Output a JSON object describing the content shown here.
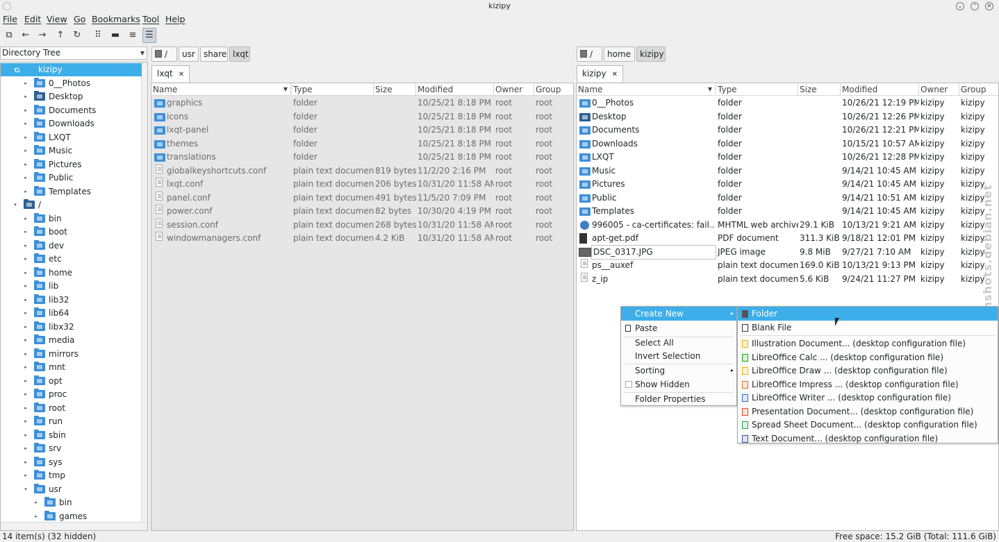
{
  "window": {
    "title": "kizipy"
  },
  "menubar": [
    "File",
    "Edit",
    "View",
    "Go",
    "Bookmarks",
    "Tool",
    "Help"
  ],
  "sidebar": {
    "combo": "Directory Tree",
    "tree": [
      {
        "label": "kizipy",
        "depth": 0,
        "exp": "▾",
        "selected": true,
        "icon": "home"
      },
      {
        "label": "0__Photos",
        "depth": 1,
        "exp": "▸"
      },
      {
        "label": "Desktop",
        "depth": 1,
        "exp": "▸",
        "icon": "dark"
      },
      {
        "label": "Documents",
        "depth": 1,
        "exp": "▸"
      },
      {
        "label": "Downloads",
        "depth": 1,
        "exp": "▸"
      },
      {
        "label": "LXQT",
        "depth": 1,
        "exp": "▸"
      },
      {
        "label": "Music",
        "depth": 1,
        "exp": "▸"
      },
      {
        "label": "Pictures",
        "depth": 1,
        "exp": "▸"
      },
      {
        "label": "Public",
        "depth": 1,
        "exp": "▸"
      },
      {
        "label": "Templates",
        "depth": 1,
        "exp": "▸"
      },
      {
        "label": "/",
        "depth": 0,
        "exp": "▾",
        "icon": "dark"
      },
      {
        "label": "bin",
        "depth": 1,
        "exp": "▸"
      },
      {
        "label": "boot",
        "depth": 1,
        "exp": "▸"
      },
      {
        "label": "dev",
        "depth": 1,
        "exp": "▸"
      },
      {
        "label": "etc",
        "depth": 1,
        "exp": "▸"
      },
      {
        "label": "home",
        "depth": 1,
        "exp": "▸"
      },
      {
        "label": "lib",
        "depth": 1,
        "exp": "▸"
      },
      {
        "label": "lib32",
        "depth": 1,
        "exp": "▸"
      },
      {
        "label": "lib64",
        "depth": 1,
        "exp": "▸"
      },
      {
        "label": "libx32",
        "depth": 1,
        "exp": "▸"
      },
      {
        "label": "media",
        "depth": 1,
        "exp": "▸"
      },
      {
        "label": "mirrors",
        "depth": 1,
        "exp": "▸"
      },
      {
        "label": "mnt",
        "depth": 1,
        "exp": "▸"
      },
      {
        "label": "opt",
        "depth": 1,
        "exp": "▸"
      },
      {
        "label": "proc",
        "depth": 1,
        "exp": "▸"
      },
      {
        "label": "root",
        "depth": 1,
        "exp": "▸"
      },
      {
        "label": "run",
        "depth": 1,
        "exp": "▸"
      },
      {
        "label": "sbin",
        "depth": 1,
        "exp": "▸"
      },
      {
        "label": "srv",
        "depth": 1,
        "exp": "▸"
      },
      {
        "label": "sys",
        "depth": 1,
        "exp": "▸"
      },
      {
        "label": "tmp",
        "depth": 1,
        "exp": "▸"
      },
      {
        "label": "usr",
        "depth": 1,
        "exp": "▾"
      },
      {
        "label": "bin",
        "depth": 2,
        "exp": "▸"
      },
      {
        "label": "games",
        "depth": 2,
        "exp": "▸"
      }
    ]
  },
  "left": {
    "path": [
      "/",
      "usr",
      "share",
      "lxqt"
    ],
    "tab": "lxqt",
    "headers": [
      "Name",
      "Type",
      "Size",
      "Modified",
      "Owner",
      "Group"
    ],
    "files": [
      {
        "name": "graphics",
        "type": "folder",
        "size": "",
        "modified": "10/25/21 8:18 PM",
        "owner": "root",
        "group": "root",
        "kind": "folder"
      },
      {
        "name": "icons",
        "type": "folder",
        "size": "",
        "modified": "10/25/21 8:18 PM",
        "owner": "root",
        "group": "root",
        "kind": "folder"
      },
      {
        "name": "lxqt-panel",
        "type": "folder",
        "size": "",
        "modified": "10/25/21 8:18 PM",
        "owner": "root",
        "group": "root",
        "kind": "folder"
      },
      {
        "name": "themes",
        "type": "folder",
        "size": "",
        "modified": "10/25/21 8:18 PM",
        "owner": "root",
        "group": "root",
        "kind": "folder"
      },
      {
        "name": "translations",
        "type": "folder",
        "size": "",
        "modified": "10/25/21 8:18 PM",
        "owner": "root",
        "group": "root",
        "kind": "folder"
      },
      {
        "name": "globalkeyshortcuts.conf",
        "type": "plain text document",
        "size": "819 bytes",
        "modified": "11/2/20 2:16 PM",
        "owner": "root",
        "group": "root",
        "kind": "text"
      },
      {
        "name": "lxqt.conf",
        "type": "plain text document",
        "size": "206 bytes",
        "modified": "10/31/20 11:58 AM",
        "owner": "root",
        "group": "root",
        "kind": "text"
      },
      {
        "name": "panel.conf",
        "type": "plain text document",
        "size": "491 bytes",
        "modified": "11/5/20 7:09 PM",
        "owner": "root",
        "group": "root",
        "kind": "text"
      },
      {
        "name": "power.conf",
        "type": "plain text document",
        "size": "82 bytes",
        "modified": "10/30/20 4:19 PM",
        "owner": "root",
        "group": "root",
        "kind": "text"
      },
      {
        "name": "session.conf",
        "type": "plain text document",
        "size": "268 bytes",
        "modified": "10/31/20 11:58 AM",
        "owner": "root",
        "group": "root",
        "kind": "text"
      },
      {
        "name": "windowmanagers.conf",
        "type": "plain text document",
        "size": "4.2  KiB",
        "modified": "10/31/20 11:58 AM",
        "owner": "root",
        "group": "root",
        "kind": "text"
      }
    ]
  },
  "right": {
    "path": [
      "/",
      "home",
      "kizipy"
    ],
    "tab": "kizipy",
    "headers": [
      "Name",
      "Type",
      "Size",
      "Modified",
      "Owner",
      "Group"
    ],
    "files": [
      {
        "name": "0__Photos",
        "type": "folder",
        "size": "",
        "modified": "10/26/21 12:19 PM",
        "owner": "kizipy",
        "group": "kizipy",
        "kind": "folder"
      },
      {
        "name": "Desktop",
        "type": "folder",
        "size": "",
        "modified": "10/26/21 12:26 PM",
        "owner": "kizipy",
        "group": "kizipy",
        "kind": "dark"
      },
      {
        "name": "Documents",
        "type": "folder",
        "size": "",
        "modified": "10/26/21 12:21 PM",
        "owner": "kizipy",
        "group": "kizipy",
        "kind": "folder"
      },
      {
        "name": "Downloads",
        "type": "folder",
        "size": "",
        "modified": "10/15/21 10:57 AM",
        "owner": "kizipy",
        "group": "kizipy",
        "kind": "folder"
      },
      {
        "name": "LXQT",
        "type": "folder",
        "size": "",
        "modified": "10/26/21 12:28 PM",
        "owner": "kizipy",
        "group": "kizipy",
        "kind": "folder"
      },
      {
        "name": "Music",
        "type": "folder",
        "size": "",
        "modified": "9/14/21 10:45 AM",
        "owner": "kizipy",
        "group": "kizipy",
        "kind": "folder"
      },
      {
        "name": "Pictures",
        "type": "folder",
        "size": "",
        "modified": "9/14/21 10:45 AM",
        "owner": "kizipy",
        "group": "kizipy",
        "kind": "folder"
      },
      {
        "name": "Public",
        "type": "folder",
        "size": "",
        "modified": "9/14/21 10:51 AM",
        "owner": "kizipy",
        "group": "kizipy",
        "kind": "folder"
      },
      {
        "name": "Templates",
        "type": "folder",
        "size": "",
        "modified": "9/14/21 10:45 AM",
        "owner": "kizipy",
        "group": "kizipy",
        "kind": "folder"
      },
      {
        "name": "996005 - ca-certificates: fail...",
        "type": "MHTML web archive",
        "size": "29.1  KiB",
        "modified": "10/13/21 9:21 AM",
        "owner": "kizipy",
        "group": "kizipy",
        "kind": "web"
      },
      {
        "name": "apt-get.pdf",
        "type": "PDF document",
        "size": "311.3  KiB",
        "modified": "9/18/21 12:01 PM",
        "owner": "kizipy",
        "group": "kizipy",
        "kind": "pdf"
      },
      {
        "name": "DSC_0317.JPG",
        "type": "JPEG image",
        "size": "9.8  MiB",
        "modified": "9/27/21 7:10 AM",
        "owner": "kizipy",
        "group": "kizipy",
        "kind": "image"
      },
      {
        "name": "ps__auxef",
        "type": "plain text document",
        "size": "169.0  KiB",
        "modified": "10/13/21 9:13 PM",
        "owner": "kizipy",
        "group": "kizipy",
        "kind": "text"
      },
      {
        "name": "z_ip",
        "type": "plain text document",
        "size": "5.6  KiB",
        "modified": "9/24/21 11:27 PM",
        "owner": "kizipy",
        "group": "kizipy",
        "kind": "text"
      }
    ]
  },
  "context_menu": {
    "items": [
      "Create New",
      "Paste",
      "Select All",
      "Invert Selection",
      "Sorting",
      "Show Hidden",
      "Folder Properties"
    ]
  },
  "submenu": {
    "items": [
      {
        "label": "Folder",
        "icon": "folder-icon",
        "color": "#555555"
      },
      {
        "label": "Blank File",
        "icon": "blank-file-icon",
        "color": "#333333"
      },
      {
        "label": "Illustration Document... (desktop configuration file)",
        "icon": "illustration-icon",
        "color": "#f0b400"
      },
      {
        "label": "LibreOffice Calc  ... (desktop configuration file)",
        "icon": "calc-icon",
        "color": "#18a303"
      },
      {
        "label": "LibreOffice Draw  ... (desktop configuration file)",
        "icon": "draw-icon",
        "color": "#f0b400"
      },
      {
        "label": "LibreOffice Impress  ... (desktop configuration file)",
        "icon": "impress-icon",
        "color": "#e06b28"
      },
      {
        "label": "LibreOffice Writer  ... (desktop configuration file)",
        "icon": "writer-icon",
        "color": "#2a6fc9"
      },
      {
        "label": "Presentation Document... (desktop configuration file)",
        "icon": "presentation-icon",
        "color": "#e04a28"
      },
      {
        "label": "Spread Sheet Document... (desktop configuration file)",
        "icon": "spreadsheet-icon",
        "color": "#27a34a"
      },
      {
        "label": "Text Document... (desktop configuration file)",
        "icon": "text-doc-icon",
        "color": "#2f4ba0"
      }
    ]
  },
  "status": {
    "left": "14 item(s) (32 hidden)",
    "right": "Free space: 15.2  GiB (Total: 111.6  GiB)"
  },
  "watermark": "screenshots.debian.net"
}
